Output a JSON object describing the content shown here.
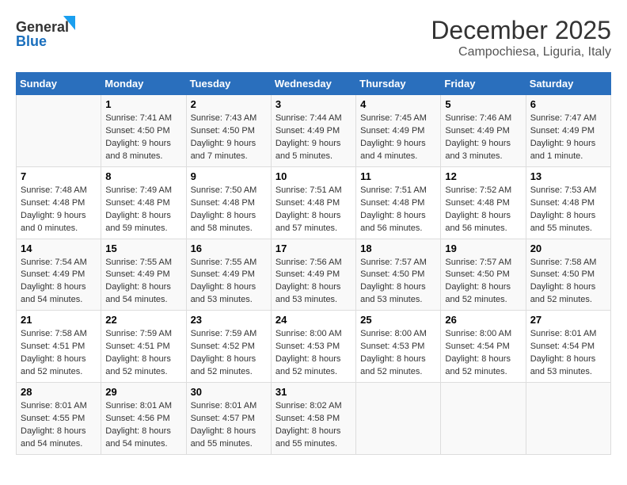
{
  "logo": {
    "line1": "General",
    "line2": "Blue"
  },
  "title": "December 2025",
  "subtitle": "Campochiesa, Liguria, Italy",
  "weekdays": [
    "Sunday",
    "Monday",
    "Tuesday",
    "Wednesday",
    "Thursday",
    "Friday",
    "Saturday"
  ],
  "weeks": [
    [
      {
        "day": "",
        "sunrise": "",
        "sunset": "",
        "daylight": ""
      },
      {
        "day": "1",
        "sunrise": "7:41 AM",
        "sunset": "4:50 PM",
        "daylight": "9 hours and 8 minutes."
      },
      {
        "day": "2",
        "sunrise": "7:43 AM",
        "sunset": "4:50 PM",
        "daylight": "9 hours and 7 minutes."
      },
      {
        "day": "3",
        "sunrise": "7:44 AM",
        "sunset": "4:49 PM",
        "daylight": "9 hours and 5 minutes."
      },
      {
        "day": "4",
        "sunrise": "7:45 AM",
        "sunset": "4:49 PM",
        "daylight": "9 hours and 4 minutes."
      },
      {
        "day": "5",
        "sunrise": "7:46 AM",
        "sunset": "4:49 PM",
        "daylight": "9 hours and 3 minutes."
      },
      {
        "day": "6",
        "sunrise": "7:47 AM",
        "sunset": "4:49 PM",
        "daylight": "9 hours and 1 minute."
      }
    ],
    [
      {
        "day": "7",
        "sunrise": "7:48 AM",
        "sunset": "4:48 PM",
        "daylight": "9 hours and 0 minutes."
      },
      {
        "day": "8",
        "sunrise": "7:49 AM",
        "sunset": "4:48 PM",
        "daylight": "8 hours and 59 minutes."
      },
      {
        "day": "9",
        "sunrise": "7:50 AM",
        "sunset": "4:48 PM",
        "daylight": "8 hours and 58 minutes."
      },
      {
        "day": "10",
        "sunrise": "7:51 AM",
        "sunset": "4:48 PM",
        "daylight": "8 hours and 57 minutes."
      },
      {
        "day": "11",
        "sunrise": "7:51 AM",
        "sunset": "4:48 PM",
        "daylight": "8 hours and 56 minutes."
      },
      {
        "day": "12",
        "sunrise": "7:52 AM",
        "sunset": "4:48 PM",
        "daylight": "8 hours and 56 minutes."
      },
      {
        "day": "13",
        "sunrise": "7:53 AM",
        "sunset": "4:48 PM",
        "daylight": "8 hours and 55 minutes."
      }
    ],
    [
      {
        "day": "14",
        "sunrise": "7:54 AM",
        "sunset": "4:49 PM",
        "daylight": "8 hours and 54 minutes."
      },
      {
        "day": "15",
        "sunrise": "7:55 AM",
        "sunset": "4:49 PM",
        "daylight": "8 hours and 54 minutes."
      },
      {
        "day": "16",
        "sunrise": "7:55 AM",
        "sunset": "4:49 PM",
        "daylight": "8 hours and 53 minutes."
      },
      {
        "day": "17",
        "sunrise": "7:56 AM",
        "sunset": "4:49 PM",
        "daylight": "8 hours and 53 minutes."
      },
      {
        "day": "18",
        "sunrise": "7:57 AM",
        "sunset": "4:50 PM",
        "daylight": "8 hours and 53 minutes."
      },
      {
        "day": "19",
        "sunrise": "7:57 AM",
        "sunset": "4:50 PM",
        "daylight": "8 hours and 52 minutes."
      },
      {
        "day": "20",
        "sunrise": "7:58 AM",
        "sunset": "4:50 PM",
        "daylight": "8 hours and 52 minutes."
      }
    ],
    [
      {
        "day": "21",
        "sunrise": "7:58 AM",
        "sunset": "4:51 PM",
        "daylight": "8 hours and 52 minutes."
      },
      {
        "day": "22",
        "sunrise": "7:59 AM",
        "sunset": "4:51 PM",
        "daylight": "8 hours and 52 minutes."
      },
      {
        "day": "23",
        "sunrise": "7:59 AM",
        "sunset": "4:52 PM",
        "daylight": "8 hours and 52 minutes."
      },
      {
        "day": "24",
        "sunrise": "8:00 AM",
        "sunset": "4:53 PM",
        "daylight": "8 hours and 52 minutes."
      },
      {
        "day": "25",
        "sunrise": "8:00 AM",
        "sunset": "4:53 PM",
        "daylight": "8 hours and 52 minutes."
      },
      {
        "day": "26",
        "sunrise": "8:00 AM",
        "sunset": "4:54 PM",
        "daylight": "8 hours and 52 minutes."
      },
      {
        "day": "27",
        "sunrise": "8:01 AM",
        "sunset": "4:54 PM",
        "daylight": "8 hours and 53 minutes."
      }
    ],
    [
      {
        "day": "28",
        "sunrise": "8:01 AM",
        "sunset": "4:55 PM",
        "daylight": "8 hours and 54 minutes."
      },
      {
        "day": "29",
        "sunrise": "8:01 AM",
        "sunset": "4:56 PM",
        "daylight": "8 hours and 54 minutes."
      },
      {
        "day": "30",
        "sunrise": "8:01 AM",
        "sunset": "4:57 PM",
        "daylight": "8 hours and 55 minutes."
      },
      {
        "day": "31",
        "sunrise": "8:02 AM",
        "sunset": "4:58 PM",
        "daylight": "8 hours and 55 minutes."
      },
      {
        "day": "",
        "sunrise": "",
        "sunset": "",
        "daylight": ""
      },
      {
        "day": "",
        "sunrise": "",
        "sunset": "",
        "daylight": ""
      },
      {
        "day": "",
        "sunrise": "",
        "sunset": "",
        "daylight": ""
      }
    ]
  ],
  "labels": {
    "sunrise_prefix": "Sunrise: ",
    "sunset_prefix": "Sunset: ",
    "daylight_prefix": "Daylight: "
  }
}
